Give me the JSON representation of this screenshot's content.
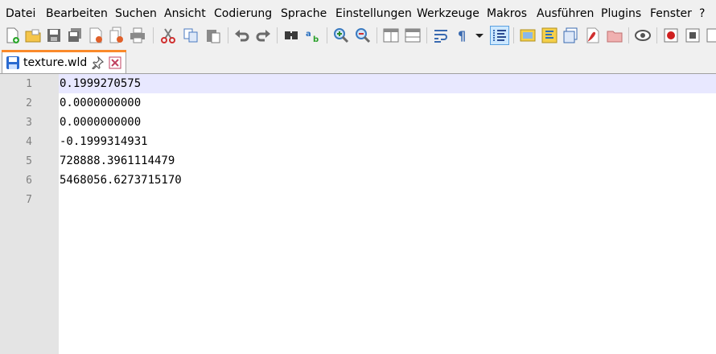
{
  "menu": [
    "Datei",
    "Bearbeiten",
    "Suchen",
    "Ansicht",
    "Codierung",
    "Sprache",
    "Einstellungen",
    "Werkzeuge",
    "Makros",
    "Ausführen",
    "Plugins",
    "Fenster",
    "?"
  ],
  "toolbar": {
    "icons": [
      "new-file-icon",
      "open-file-icon",
      "save-icon",
      "save-all-icon",
      "close-icon",
      "close-all-icon",
      "print-icon",
      "cut-icon",
      "copy-icon",
      "paste-icon",
      "undo-icon",
      "redo-icon",
      "find-icon",
      "replace-icon",
      "zoom-in-icon",
      "zoom-out-icon",
      "sync-vertical-icon",
      "sync-horizontal-icon",
      "word-wrap-icon",
      "show-all-chars-icon",
      "indent-guide-icon",
      "document-map-icon",
      "function-list-icon",
      "folder-as-workspace-icon",
      "monitoring-icon",
      "record-macro-icon",
      "stop-record-icon"
    ],
    "accent": "#0078d7"
  },
  "tab": {
    "filename": "texture.wld",
    "pin_icon": "pin-icon",
    "close_icon": "close-tab-icon",
    "accent": "#fa8a2b"
  },
  "editor": {
    "lines": [
      {
        "number": "1",
        "text": "0.1999270575"
      },
      {
        "number": "2",
        "text": "0.0000000000"
      },
      {
        "number": "3",
        "text": "0.0000000000"
      },
      {
        "number": "4",
        "text": "-0.1999314931"
      },
      {
        "number": "5",
        "text": "728888.3961114479"
      },
      {
        "number": "6",
        "text": "5468056.6273715170"
      },
      {
        "number": "7",
        "text": ""
      }
    ],
    "current_line_color": "#e8e8ff"
  }
}
